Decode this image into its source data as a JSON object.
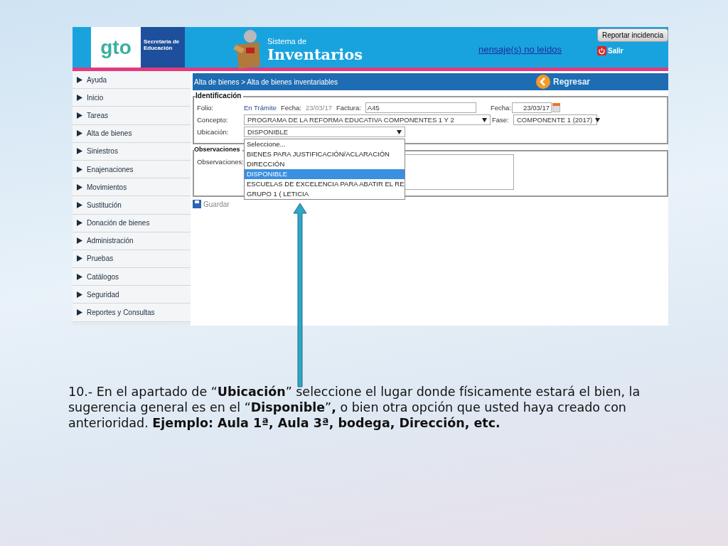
{
  "header": {
    "logo_text": "gto",
    "department": "Secretaría de Educación",
    "system_subtitle": "Sistema de",
    "system_title": "Inventarios",
    "messages_link": "nensaje(s) no leídos",
    "report_button": "Reportar incidencia",
    "exit_button": "Salir"
  },
  "sidebar": {
    "items": [
      {
        "label": "Ayuda"
      },
      {
        "label": "Inicio"
      },
      {
        "label": "Tareas"
      },
      {
        "label": "Alta de bienes"
      },
      {
        "label": "Siniestros"
      },
      {
        "label": "Enajenaciones"
      },
      {
        "label": "Movimientos"
      },
      {
        "label": "Sustitución"
      },
      {
        "label": "Donación de bienes"
      },
      {
        "label": "Administración"
      },
      {
        "label": "Pruebas"
      },
      {
        "label": "Catálogos"
      },
      {
        "label": "Seguridad"
      },
      {
        "label": "Reportes y Consultas"
      }
    ]
  },
  "breadcrumb": "Alta de bienes > Alta de bienes inventariables",
  "back_button": "Regresar",
  "identificacion": {
    "legend": "Identificación",
    "folio_label": "Folio:",
    "folio_value": "En Trámite",
    "fecha_label": "Fecha:",
    "fecha_value": "23/03/17",
    "factura_label": "Factura:",
    "factura_value": "A45",
    "concepto_label": "Concepto:",
    "concepto_value": "PROGRAMA DE LA REFORMA EDUCATIVA COMPONENTES 1 Y 2",
    "fecha2_label": "Fecha:",
    "fecha2_value": "23/03/17",
    "fase_label": "Fase:",
    "fase_value": "COMPONENTE 1 (2017)",
    "ubicacion_label": "Ubicación:",
    "ubicacion_value": "DISPONIBLE",
    "ubicacion_options": [
      {
        "label": "Seleccione...",
        "selected": false
      },
      {
        "label": "BIENES PARA JUSTIFICACIÓN/ACLARACIÓN",
        "selected": false
      },
      {
        "label": "DIRECCIÓN",
        "selected": false
      },
      {
        "label": "DISPONIBLE",
        "selected": true
      },
      {
        "label": "ESCUELAS DE EXCELENCIA PARA ABATIR EL RE",
        "selected": false
      },
      {
        "label": "GRUPO 1 ( LETICIA",
        "selected": false
      }
    ]
  },
  "observaciones": {
    "legend": "Observaciones",
    "label": "Observaciones:"
  },
  "save_button": "Guardar",
  "caption": "10.- En el apartado de “**Ubicación**” seleccione el lugar donde físicamente estará  el bien, la sugerencia general es en el “**Disponible**”**,** o bien otra opción que usted haya creado con anterioridad. **Ejemplo: Aula 1ª, Aula 3ª, bodega, Dirección,  etc.**"
}
